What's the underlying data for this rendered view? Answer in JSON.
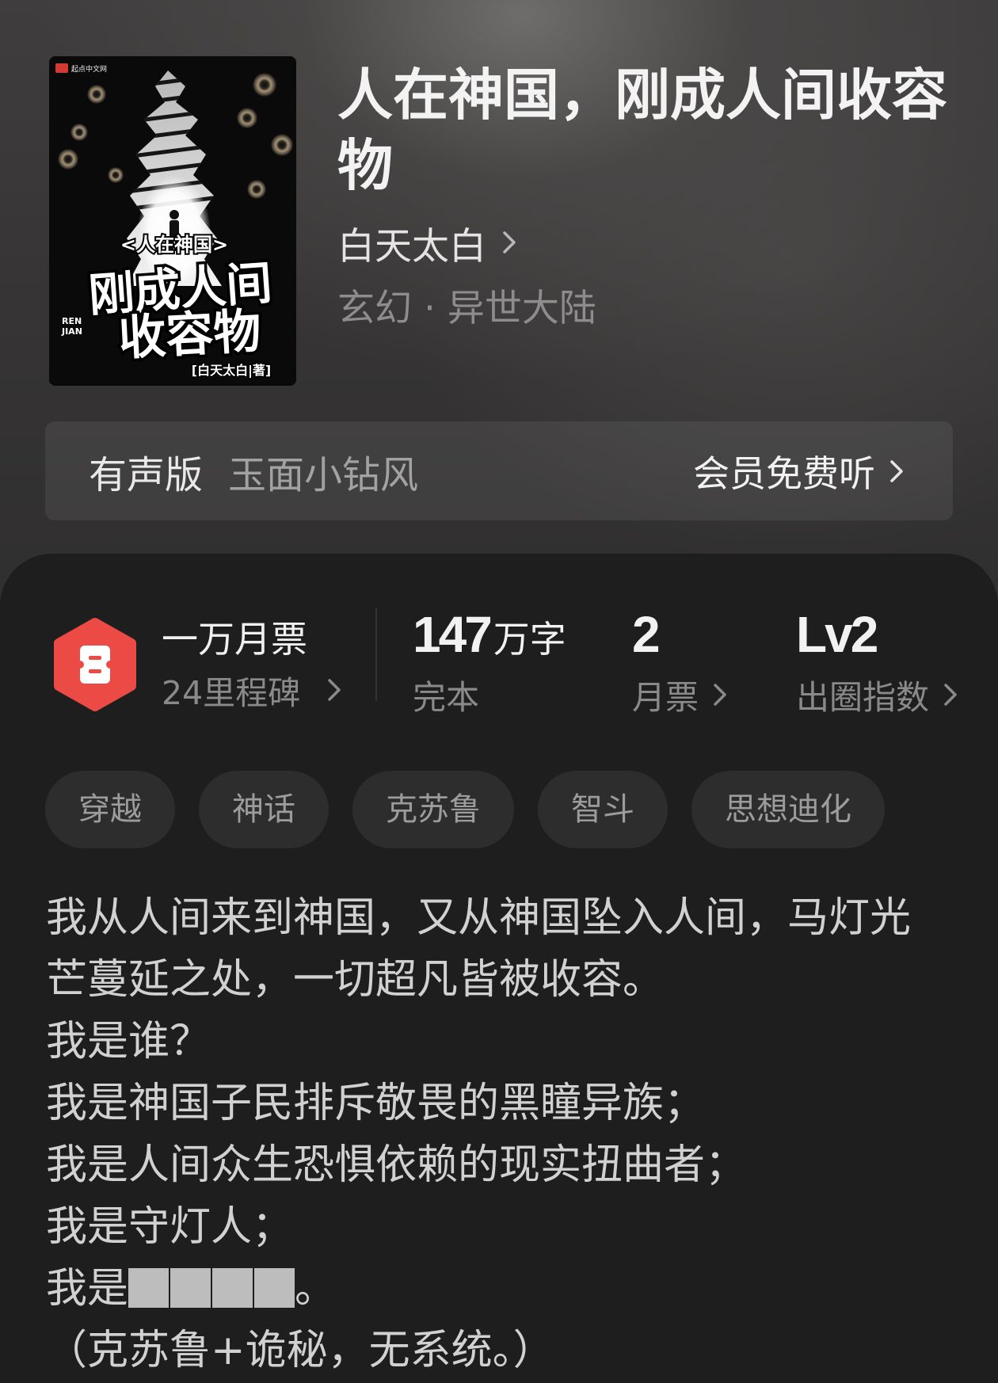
{
  "book": {
    "title": "人在神国，刚成人间收容物",
    "author": "白天太白",
    "category": "玄幻 · 异世大陆"
  },
  "cover": {
    "publisher_logo": "起点中文网",
    "series_tag": "<人在神国>",
    "title_line1": "刚成人间",
    "title_line2": "收容物",
    "pinyin_top": "REN",
    "pinyin_bottom": "JIAN",
    "author_credit": "[白天太白|著]"
  },
  "audio": {
    "label": "有声版",
    "narrator": "玉面小钻风",
    "action": "会员免费听"
  },
  "stats": {
    "tickets": {
      "title": "一万月票",
      "subtitle": "24里程碑"
    },
    "words": {
      "number": "147",
      "unit": "万字",
      "status": "完本"
    },
    "monthly": {
      "value": "2",
      "label": "月票"
    },
    "influence": {
      "value": "Lv2",
      "label": "出圈指数"
    }
  },
  "tags": [
    "穿越",
    "神话",
    "克苏鲁",
    "智斗",
    "思想迪化"
  ],
  "description": {
    "lines": [
      "我从人间来到神国，又从神国坠入人间，马灯光",
      "芒蔓延之处，一切超凡皆被收容。",
      "我是谁？",
      "我是神国子民排斥敬畏的黑瞳异族；",
      "我是人间众生恐惧依赖的现实扭曲者；",
      "我是守灯人；"
    ],
    "redacted_line": {
      "before": "我是",
      "redacted_count": 4,
      "after": "。"
    },
    "closing": "（克苏鲁+诡秘，无系统。）"
  },
  "icons": {
    "milestone": "ticket-hexagon-icon",
    "more": "chevron-right-icon"
  },
  "colors": {
    "accent_red": "#ec4a45",
    "card_background": "#1e1e1e",
    "tag_background": "#2d2d2d",
    "text_primary": "#f0f0f0",
    "text_secondary": "#8a8a8a",
    "redaction": "#bdbdbd"
  }
}
